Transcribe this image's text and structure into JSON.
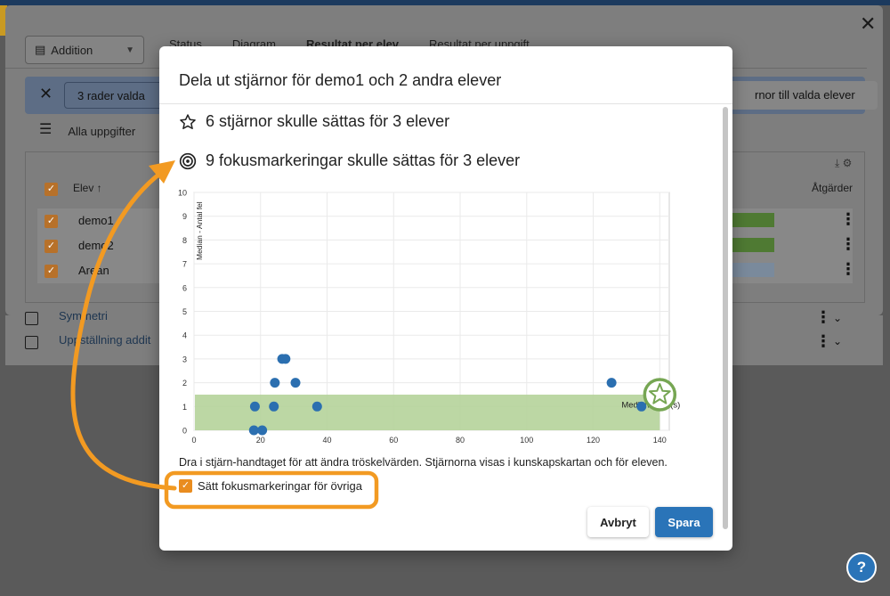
{
  "background": {
    "select_value": "Addition",
    "tabs": [
      "Status",
      "Diagram",
      "Resultat per elev",
      "Resultat per uppgift"
    ],
    "selection_bar": {
      "rows_selected": "3 rader valda",
      "assign_button": "rnor till valda elever"
    },
    "filter_label": "Alla uppgifter",
    "table": {
      "col_student": "Elev",
      "col_actions": "Åtgärder",
      "rows": [
        "demo1",
        "demo2",
        "Arean"
      ]
    },
    "lower_rows": [
      "Symmetri",
      "Uppställning addit"
    ]
  },
  "modal": {
    "title": "Dela ut stjärnor för demo1 och 2 andra elever",
    "stars_line": "6 stjärnor skulle sättas för 3 elever",
    "focus_line": "9 fokusmarkeringar skulle sättas för 3 elever",
    "hint": "Dra i stjärn-handtaget för att ändra tröskelvärden. Stjärnorna visas i kunskapskartan och för eleven.",
    "checkbox_label": "Sätt fokusmarkeringar för övriga",
    "checkbox_checked": true,
    "cancel_label": "Avbryt",
    "save_label": "Spara"
  },
  "chart_data": {
    "type": "scatter",
    "xlabel": "Median - Tid (s)",
    "ylabel": "Median - Antal fel",
    "xlim": [
      0,
      140
    ],
    "ylim": [
      0,
      10
    ],
    "xticks": [
      0,
      20,
      40,
      60,
      80,
      100,
      120,
      140
    ],
    "yticks": [
      0,
      1,
      2,
      3,
      4,
      5,
      6,
      7,
      8,
      9,
      10
    ],
    "grid": true,
    "threshold": {
      "x": 140,
      "y": 1.5
    },
    "points": [
      {
        "x": 18,
        "y": 0
      },
      {
        "x": 20.5,
        "y": 0
      },
      {
        "x": 18.3,
        "y": 1
      },
      {
        "x": 24,
        "y": 1
      },
      {
        "x": 24.3,
        "y": 2
      },
      {
        "x": 26.5,
        "y": 3
      },
      {
        "x": 27.5,
        "y": 3
      },
      {
        "x": 30.5,
        "y": 2
      },
      {
        "x": 37,
        "y": 1
      },
      {
        "x": 125.5,
        "y": 2
      },
      {
        "x": 134.5,
        "y": 1
      }
    ],
    "colors": {
      "point": "#2b6fb0",
      "zone": "#b5d39a",
      "handle": "#76a653"
    }
  },
  "help_icon": "help-icon"
}
